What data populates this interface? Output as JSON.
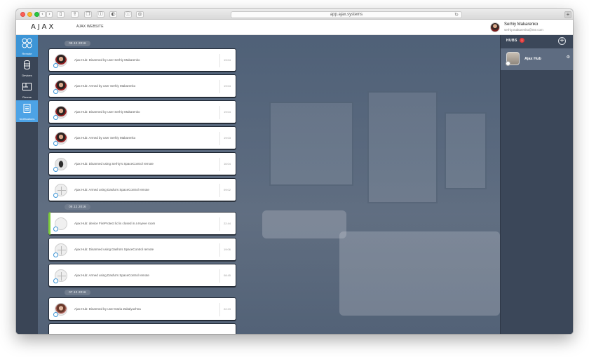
{
  "browser": {
    "url": "app.ajax.systems",
    "new_tab": "+"
  },
  "header": {
    "logo": "AJAX",
    "website_link": "AJAX WEBSITE",
    "user_name": "Serhiy Makarenko",
    "user_email": "serhiy.makarenko@me.com"
  },
  "nav": {
    "items": [
      {
        "label": "Remote",
        "icon": "remote-icon"
      },
      {
        "label": "Devices",
        "icon": "devices-icon"
      },
      {
        "label": "Rooms",
        "icon": "rooms-icon"
      },
      {
        "label": "Notifications",
        "icon": "notifications-icon"
      }
    ]
  },
  "feed": {
    "groups": [
      {
        "date": "09.12.2016",
        "items": [
          {
            "message": "Ajax Hub: Disarmed by user Serhiy Makarenko",
            "time": "19:04",
            "thumb": "person"
          },
          {
            "message": "Ajax Hub: Armed by user Serhiy Makarenko",
            "time": "19:04",
            "thumb": "person"
          },
          {
            "message": "Ajax Hub: Disarmed by user Serhiy Makarenko",
            "time": "19:04",
            "thumb": "person"
          },
          {
            "message": "Ajax Hub: Armed by user Serhiy Makarenko",
            "time": "19:03",
            "thumb": "person"
          },
          {
            "message": "Ajax Hub: Disarmed using Serhiy's SpaceControl remote",
            "time": "16:04",
            "thumb": "remote"
          },
          {
            "message": "Ajax Hub: Armed using Dasha's SpaceControl remote",
            "time": "09:02",
            "thumb": "remote-w"
          }
        ]
      },
      {
        "date": "08.12.2016",
        "items": [
          {
            "message": "Ajax Hub: device FireProtect lid is closed in a Kyeve room",
            "time": "22:44",
            "thumb": "device"
          },
          {
            "message": "Ajax Hub: Disarmed using Dasha's SpaceControl remote",
            "time": "19:06",
            "thumb": "remote-w"
          },
          {
            "message": "Ajax Hub: Armed using Dasha's SpaceControl remote",
            "time": "08:45",
            "thumb": "remote-w"
          }
        ]
      },
      {
        "date": "07.12.2016",
        "items": [
          {
            "message": "Ajax Hub: Disarmed by user Daria Zakalyuzhna",
            "time": "22:23",
            "thumb": "woman"
          }
        ]
      }
    ]
  },
  "hubs": {
    "title": "HUBS",
    "count": "1",
    "add": "+",
    "items": [
      {
        "name": "Ajax Hub"
      }
    ]
  }
}
